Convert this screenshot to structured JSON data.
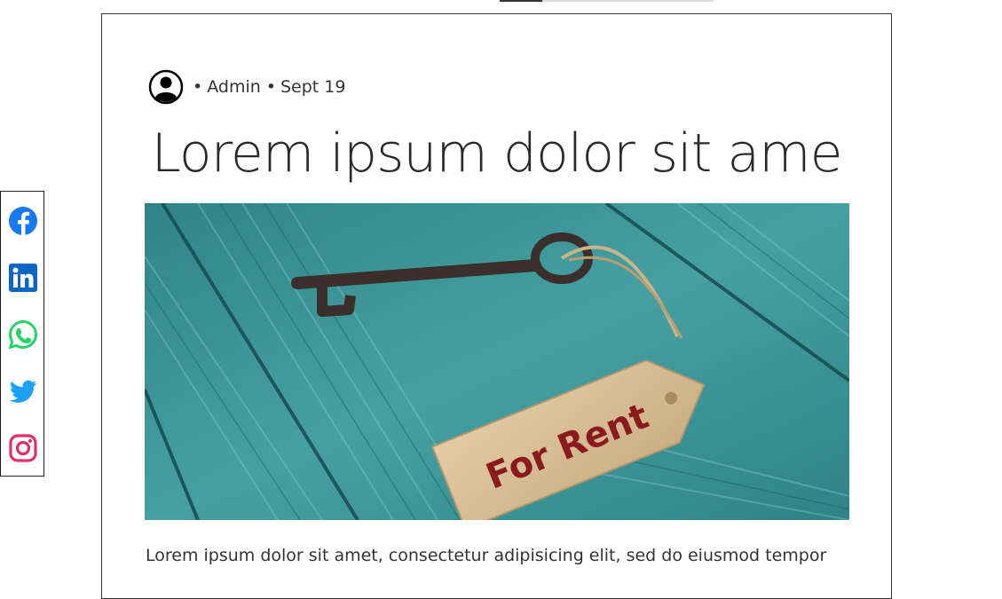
{
  "nav": {
    "active_indicator": true
  },
  "post": {
    "author_prefix": "•",
    "author": "Admin",
    "date_prefix": "•",
    "date": "Sept 19",
    "title": "Lorem ipsum dolor sit ame",
    "image": {
      "tag_text": "For Rent",
      "alt": "Key with For Rent tag on teal wooden boards"
    },
    "excerpt": "Lorem ipsum dolor sit amet, consectetur adipisicing elit, sed do eiusmod tempor"
  },
  "share": {
    "items": [
      {
        "network": "facebook",
        "icon": "facebook-icon",
        "color": "#1877F2"
      },
      {
        "network": "linkedin",
        "icon": "linkedin-icon",
        "color": "#0A66C2"
      },
      {
        "network": "whatsapp",
        "icon": "whatsapp-icon",
        "color": "#25D366"
      },
      {
        "network": "twitter",
        "icon": "twitter-icon",
        "color": "#1DA1F2"
      },
      {
        "network": "instagram",
        "icon": "instagram-icon",
        "color": "#E1306C"
      }
    ]
  },
  "colors": {
    "border": "#333333",
    "text": "#333333",
    "title": "#2a2a2a",
    "wood": "#3a8f93",
    "tag": "#d8bf97",
    "tag_text": "#8b1a1f"
  }
}
